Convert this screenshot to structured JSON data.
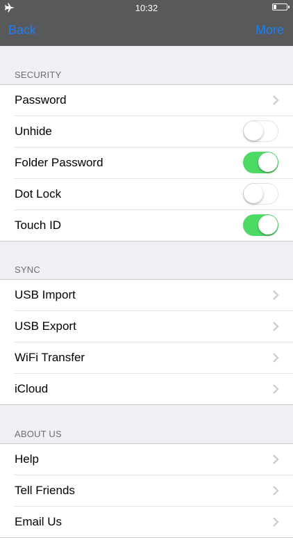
{
  "status_bar": {
    "time": "10:32",
    "battery_level": 0.2
  },
  "nav": {
    "back_label": "Back",
    "more_label": "More"
  },
  "colors": {
    "accent": "#1f7ff3",
    "switch_on": "#4cd964",
    "header_bg": "#58595b",
    "page_bg": "#efeff4"
  },
  "sections": [
    {
      "title": "SECURITY",
      "rows": [
        {
          "label": "Password",
          "control": "chevron"
        },
        {
          "label": "Unhide",
          "control": "switch",
          "on": false
        },
        {
          "label": "Folder Password",
          "control": "switch",
          "on": true
        },
        {
          "label": "Dot Lock",
          "control": "switch",
          "on": false
        },
        {
          "label": "Touch ID",
          "control": "switch",
          "on": true
        }
      ]
    },
    {
      "title": "SYNC",
      "rows": [
        {
          "label": "USB Import",
          "control": "chevron"
        },
        {
          "label": "USB Export",
          "control": "chevron"
        },
        {
          "label": "WiFi Transfer",
          "control": "chevron"
        },
        {
          "label": "iCloud",
          "control": "chevron"
        }
      ]
    },
    {
      "title": "ABOUT US",
      "rows": [
        {
          "label": "Help",
          "control": "chevron"
        },
        {
          "label": "Tell Friends",
          "control": "chevron"
        },
        {
          "label": "Email Us",
          "control": "chevron"
        }
      ]
    }
  ]
}
